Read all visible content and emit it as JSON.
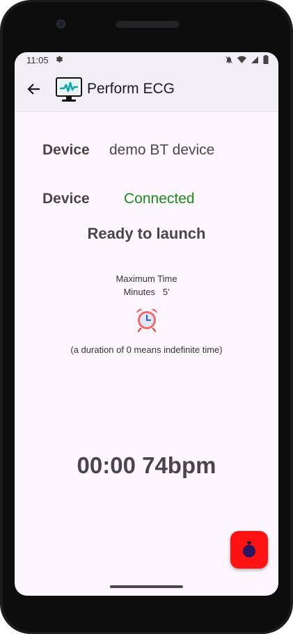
{
  "status_bar": {
    "time": "11:05",
    "icons": [
      "settings-gear-icon",
      "notifications-off-icon",
      "wifi-icon",
      "signal-icon",
      "battery-icon"
    ]
  },
  "app_bar": {
    "title": "Perform ECG",
    "back_icon": "arrow-back-icon",
    "app_icon": "ecg-monitor-icon"
  },
  "device_name_row": {
    "label": "Device",
    "value": "demo BT device"
  },
  "device_status_row": {
    "label": "Device",
    "value": "Connected",
    "value_color": "#1b8a1b"
  },
  "status_message": "Ready to launch",
  "max_time": {
    "heading": "Maximum Time",
    "minutes_label": "Minutes",
    "minutes_value": "5'",
    "alarm_icon": "alarm-clock-icon",
    "note": "(a duration of 0 means indefinite time)"
  },
  "readout": "00:00 74bpm",
  "fab": {
    "icon": "stopwatch-icon",
    "color": "#ff1212"
  },
  "colors": {
    "screen_bg": "#fdf7fd",
    "appbar_bg": "#f2eef5",
    "text_primary": "#49454f"
  }
}
